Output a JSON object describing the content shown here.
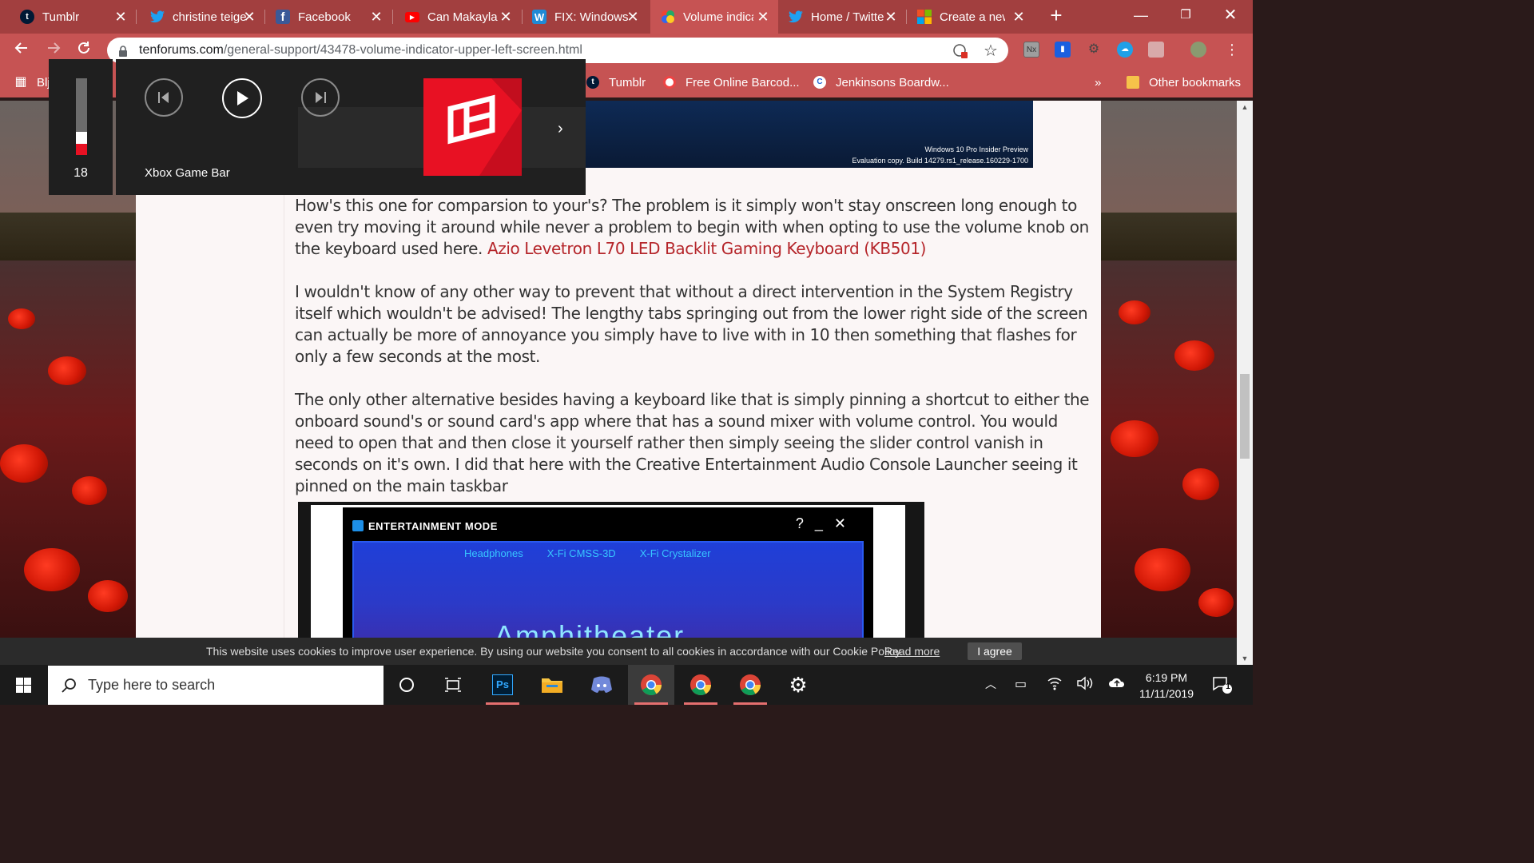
{
  "browser": {
    "tabs": [
      {
        "title": "Tumblr",
        "icon": "tumblr-icon",
        "active": false
      },
      {
        "title": "christine teigen",
        "icon": "twitter-icon",
        "active": false
      },
      {
        "title": "Facebook",
        "icon": "facebook-icon",
        "active": false
      },
      {
        "title": "Can Makayla",
        "icon": "youtube-icon",
        "active": false
      },
      {
        "title": "FIX: Windows",
        "icon": "w-icon",
        "active": false
      },
      {
        "title": "Volume indicator",
        "icon": "tenforums-icon",
        "active": true
      },
      {
        "title": "Home / Twitter",
        "icon": "twitter-icon",
        "active": false
      },
      {
        "title": "Create a new",
        "icon": "microsoft-icon",
        "active": false
      }
    ],
    "url_domain": "tenforums.com",
    "url_path": "/general-support/43478-volume-indicator-upper-left-screen.html",
    "bookmarks": [
      {
        "label": "Blj",
        "icon": "apps-icon"
      },
      {
        "label": "Tumblr",
        "icon": "tumblr-icon"
      },
      {
        "label": "Free Online Barcod...",
        "icon": "barcode-icon"
      },
      {
        "label": "Jenkinsons Boardw...",
        "icon": "jenkinsons-icon"
      }
    ],
    "bookmarks_overflow": "»",
    "other_bookmarks": "Other bookmarks"
  },
  "overlay": {
    "volume_level": 18,
    "media_source": "Xbox Game Bar"
  },
  "article": {
    "para1_text": "How's this one for comparsion to your's? The problem is it simply won't stay onscreen long enough to even try moving it around while never a problem to begin with when opting to use the volume knob on the keyboard used here.",
    "para1_link": "Azio Levetron L70 LED Backlit Gaming Keyboard (KB501)",
    "para2": "I wouldn't know of any other way to prevent that without a direct intervention in the System Registry itself which wouldn't be advised! The lengthy tabs springing out from the lower right side of the screen can actually be more of annoyance you simply have to live with in 10 then something that flashes for only a few seconds at the most.",
    "para3": "The only other alternative besides having a keyboard like that is simply pinning a shortcut to either the onboard sound's or sound card's app where that has a sound mixer with volume control. You would need to open that and then close it yourself rather then simply seeing the slider control vanish in seconds on it's own. I did that here with the Creative Entertainment Audio Console Launcher seeing it pinned on the main taskbar",
    "shot1_watermark_1": "Windows 10 Pro Insider Preview",
    "shot1_watermark_2": "Evaluation copy. Build 14279.rs1_release.160229-1700",
    "shot2_title": "ENTERTAINMENT MODE",
    "shot2_options": [
      "Headphones",
      "X-Fi CMSS-3D",
      "X-Fi Crystalizer"
    ],
    "shot2_big": "Amphitheater"
  },
  "cookie": {
    "message": "This website uses cookies to improve user experience. By using our website you consent to all cookies in accordance with our Cookie Policy.",
    "read_more": "Read more",
    "agree": "I agree"
  },
  "taskbar": {
    "search_placeholder": "Type here to search",
    "time": "6:19 PM",
    "date": "11/11/2019",
    "notification_count": "1"
  },
  "colors": {
    "chrome_frame": "#a23f3f",
    "chrome_toolbar": "#c65353",
    "link": "#b5252a",
    "volume_fill": "#e81123"
  }
}
